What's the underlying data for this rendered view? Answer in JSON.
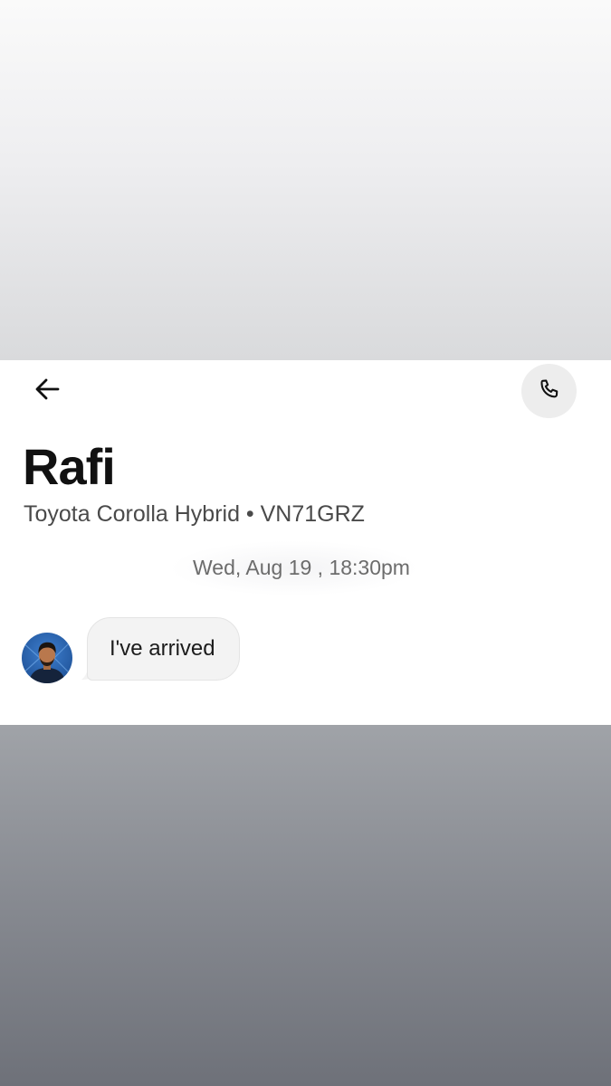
{
  "header": {
    "back_icon": "arrow-left-icon",
    "call_icon": "phone-icon"
  },
  "driver": {
    "name": "Rafi",
    "vehicle": "Toyota Corolla Hybrid • VN71GRZ"
  },
  "conversation": {
    "timestamp": "Wed, Aug 19 , 18:30pm",
    "messages": [
      {
        "sender": "driver",
        "text": "I've arrived"
      }
    ]
  },
  "colors": {
    "card_background": "#ffffff",
    "call_button_background": "#ededed",
    "bubble_background": "#f3f3f3",
    "primary_text": "#111111",
    "secondary_text": "#4a4a4a"
  }
}
